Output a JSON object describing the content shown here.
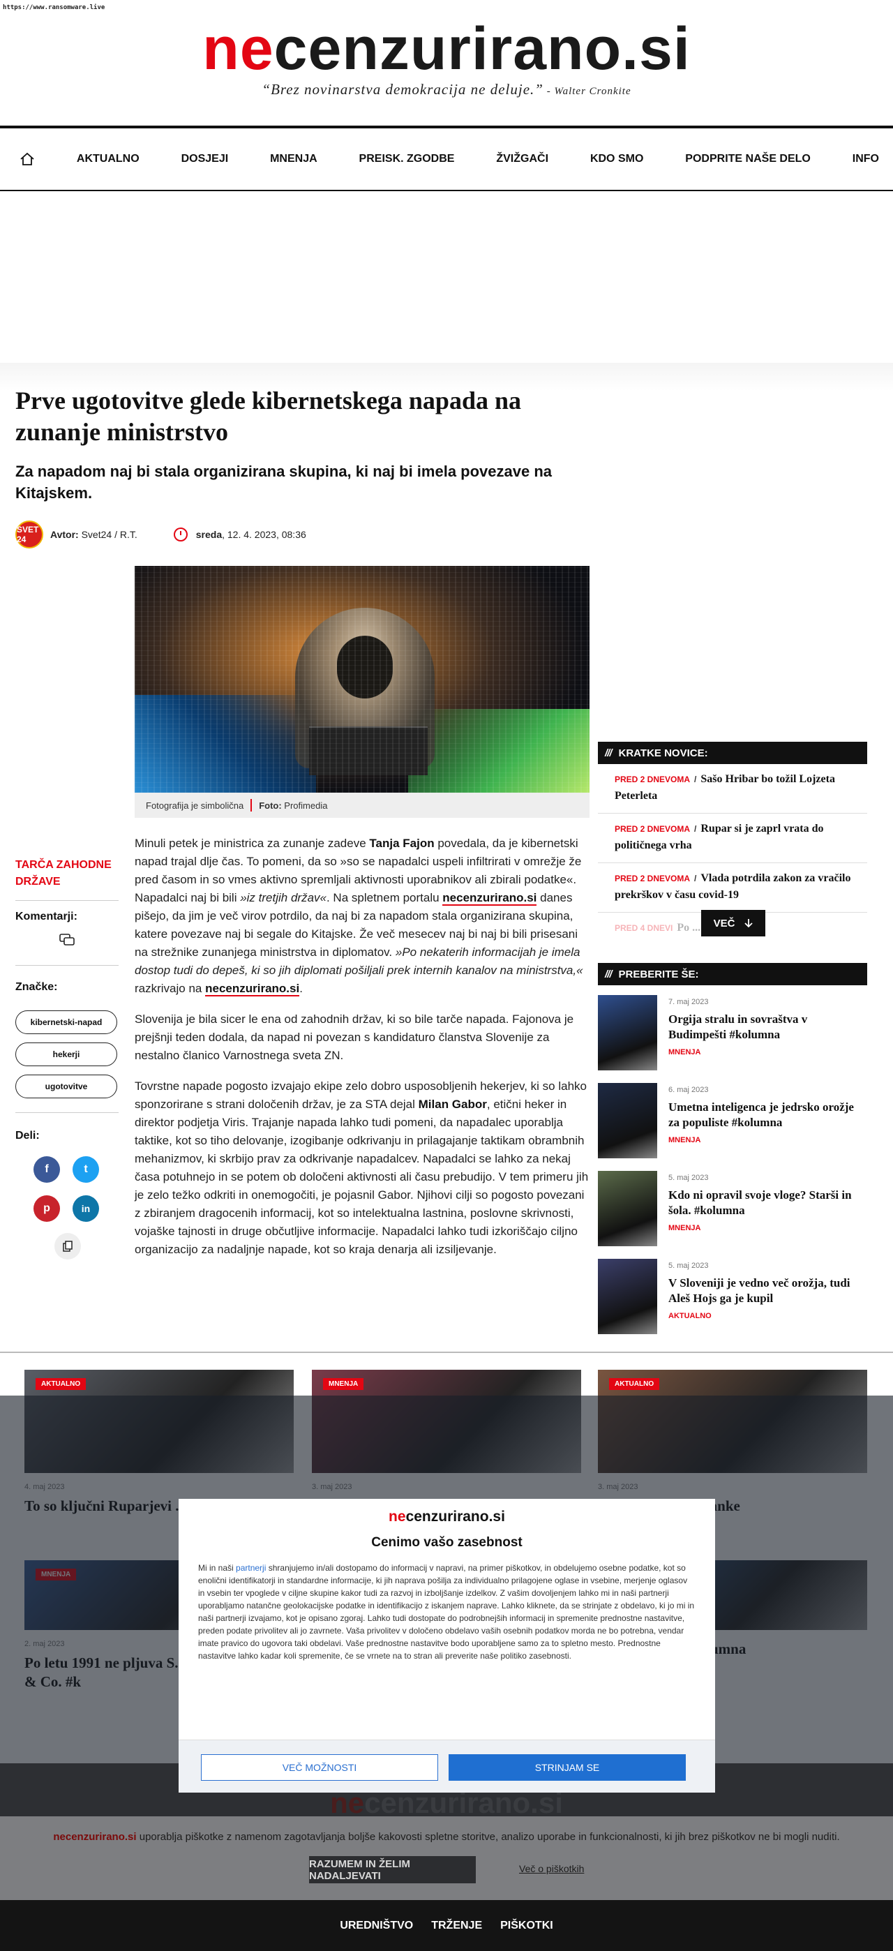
{
  "url": "https://www.ransomware.live",
  "brand": {
    "prefix": "ne",
    "rest": "cenzurirano.si"
  },
  "motto": {
    "quote": "“Brez novinarstva demokracija ne deluje.”",
    "author": " - Walter Cronkite"
  },
  "nav": [
    "AKTUALNO",
    "DOSJEJI",
    "MNENJA",
    "PREISK. ZGODBE",
    "ŽVIŽGAČI",
    "KDO SMO",
    "PODPRITE NAŠE DELO",
    "INFO"
  ],
  "article": {
    "title": "Prve ugotovitve glede kibernetskega napada na zunanje ministrstvo",
    "lede": "Za napadom naj bi stala organizirana skupina, ki naj bi imela povezave na Kitajskem.",
    "avatar_text": "SVET 24",
    "author_label": "Avtor:",
    "author": "Svet24 / R.T.",
    "day": "sreda",
    "date": ", 12. 4. 2023, 08:36",
    "caption": "Fotografija je simbolična",
    "photo_label": "Foto:",
    "photo_credit": "Profimedia",
    "p1_a": "Minuli petek je ministrica za zunanje zadeve ",
    "p1_b": "Tanja Fajon",
    "p1_c": " povedala, da je kibernetski napad trajal dlje čas. To pomeni, da so »so se napadalci uspeli infiltrirati v omrežje že pred časom in so vmes aktivno spremljali aktivnosti uporabnikov ali zbirali podatke«. Napadalci naj bi bili ",
    "p1_d": "»iz tretjih držav«",
    "p1_e": ". Na spletnem portalu ",
    "p1_link": "necenzurirano.si",
    "p1_f": " danes pišejo, da jim je več virov potrdilo, da naj bi za napadom stala organizirana skupina, katere povezave naj bi segale do Kitajske. Že več mesecev naj bi naj bi bili prisesani na strežnike zunanjega ministrstva in diplomatov. ",
    "p1_g": "»Po nekaterih informacijah je imela dostop tudi do depeš, ki so jih diplomati pošiljali prek internih kanalov na ministrstva,«",
    "p1_h": " razkrivajo na ",
    "p1_link2": "necenzurirano.si",
    "p1_i": ".",
    "p2": "Slovenija je bila sicer le ena od zahodnih držav, ki so bile tarče napada. Fajonova je prejšnji teden dodala, da napad ni povezan s kandidaturo članstva Slovenije za nestalno članico Varnostnega sveta ZN.",
    "p3_a": "Tovrstne napade pogosto izvajajo ekipe zelo dobro usposobljenih hekerjev, ki so lahko sponzorirane s strani določenih držav, je za STA dejal ",
    "p3_b": "Milan Gabor",
    "p3_c": ", etični heker in direktor podjetja Viris. Trajanje napada lahko tudi pomeni, da napadalec uporablja taktike, kot so tiho delovanje, izogibanje odkrivanju in prilagajanje taktikam obrambnih mehanizmov, ki skrbijo prav za odkrivanje napadalcev. Napadalci se lahko za nekaj časa potuhnejo in se potem ob določeni aktivnosti ali času prebudijo. V tem primeru jih je zelo težko odkriti in onemogočiti, je pojasnil Gabor. Njihovi cilji so pogosto povezani z zbiranjem dragocenih informacij, kot so intelektualna lastnina, poslovne skrivnosti, vojaške tajnosti in druge občutljive informacije. Napadalci lahko tudi izkoriščajo ciljno organizacijo za nadaljnje napade, kot so kraja denarja ali izsiljevanje."
  },
  "left": {
    "category": "TARČA ZAHODNE DRŽAVE",
    "comments": "Komentarji:",
    "tags_label": "Značke:",
    "tags": [
      "kibernetski-napad",
      "hekerji",
      "ugotovitve"
    ],
    "share": "Deli:",
    "social": [
      "f",
      "t",
      "p",
      "in"
    ]
  },
  "kratke": {
    "title": "KRATKE NOVICE:",
    "items": [
      {
        "time": "PRED 2 DNEVOMA",
        "text": "Sašo Hribar bo tožil Lojzeta Peterleta"
      },
      {
        "time": "PRED 2 DNEVOMA",
        "text": "Rupar si je zaprl vrata do političnega vrha"
      },
      {
        "time": "PRED 2 DNEVOMA",
        "text": "Vlada potrdila zakon za vračilo prekrškov v času covid-19"
      },
      {
        "time": "PRED 4 DNEVI",
        "text": "Po ... ve vlade spet"
      }
    ],
    "more": "VEČ"
  },
  "preberite": {
    "title": "PREBERITE ŠE:",
    "items": [
      {
        "date": "7. maj 2023",
        "title": "Orgija stralu in sovraštva v Budimpešti #kolumna",
        "cat": "MNENJA",
        "color": "#2f4f8f"
      },
      {
        "date": "6. maj 2023",
        "title": "Umetna inteligenca je jedrsko orožje za populiste #kolumna",
        "cat": "MNENJA",
        "color": "#1e2a44"
      },
      {
        "date": "5. maj 2023",
        "title": "Kdo ni opravil svoje vloge? Starši in šola. #kolumna",
        "cat": "MNENJA",
        "color": "#5b6b4a"
      },
      {
        "date": "5. maj 2023",
        "title": "V Sloveniji je vedno več orožja, tudi Aleš Hojs ga je kupil",
        "cat": "AKTUALNO",
        "color": "#3b3f6a"
      }
    ]
  },
  "cards": [
    {
      "badge": "AKTUALNO",
      "date": "4. maj 2023",
      "title": "To so ključni Ruparjevi ... iz SDS",
      "color": "#5a5e66"
    },
    {
      "badge": "MNENJA",
      "date": "3. maj 2023",
      "title": "",
      "color": "#7a3b4a"
    },
    {
      "badge": "AKTUALNO",
      "date": "3. maj 2023",
      "title": "... prodajo hišne banke",
      "color": "#7a5540"
    },
    {
      "badge": "MNENJA",
      "date": "2. maj 2023",
      "title": "Po letu 1991 ne pljuva S... ampak Peterle & Co. #k",
      "color": "#3a5f9a"
    },
    {
      "badge": "",
      "date": "",
      "title": "",
      "color": "#6b6e74"
    },
    {
      "badge": "",
      "date": "",
      "title": "... o denarja? #kolumna",
      "color": "#3c6fb0"
    }
  ],
  "modal": {
    "heading": "Cenimo vašo zasebnost",
    "text_a": "Mi in naši ",
    "text_link": "partnerji",
    "text_b": " shranjujemo in/ali dostopamo do informacij v napravi, na primer piškotkov, in obdelujemo osebne podatke, kot so enolični identifikatorji in standardne informacije, ki jih naprava pošilja za individualno prilagojene oglase in vsebine, merjenje oglasov in vsebin ter vpoglede v ciljne skupine kakor tudi za razvoj in izboljšanje izdelkov. Z vašim dovoljenjem lahko mi in naši partnerji uporabljamo natančne geolokacijske podatke in identifikacijo z iskanjem naprave. Lahko kliknete, da se strinjate z obdelavo, ki jo mi in naši partnerji izvajamo, kot je opisano zgoraj. Lahko tudi dostopate do podrobnejših informacij in spremenite prednostne nastavitve, preden podate privolitev ali jo zavrnete. Vaša privolitev v določeno obdelavo vaših osebnih podatkov morda ne bo potrebna, vendar imate pravico do ugovora taki obdelavi. Vaše prednostne nastavitve bodo uporabljene samo za to spletno mesto. Prednostne nastavitve lahko kadar koli spremenite, če se vrnete na to stran ali preverite naše politiko zasebnosti.",
    "more_options": "VEČ MOŽNOSTI",
    "agree": "STRINJAM SE"
  },
  "cookie": {
    "brand": "necenzurirano.si",
    "text": " uporablja piškotke z namenom zagotavljanja boljše kakovosti spletne storitve, analizo uporabe in funkcionalnosti, ki jih brez piškotkov ne bi mogli nuditi.",
    "button": "RAZUMEM IN ŽELIM NADALJEVATI",
    "link": "Več o piškotkih"
  },
  "footer": [
    "UREDNIŠTVO",
    "TRŽENJE",
    "PIŠKOTKI"
  ]
}
